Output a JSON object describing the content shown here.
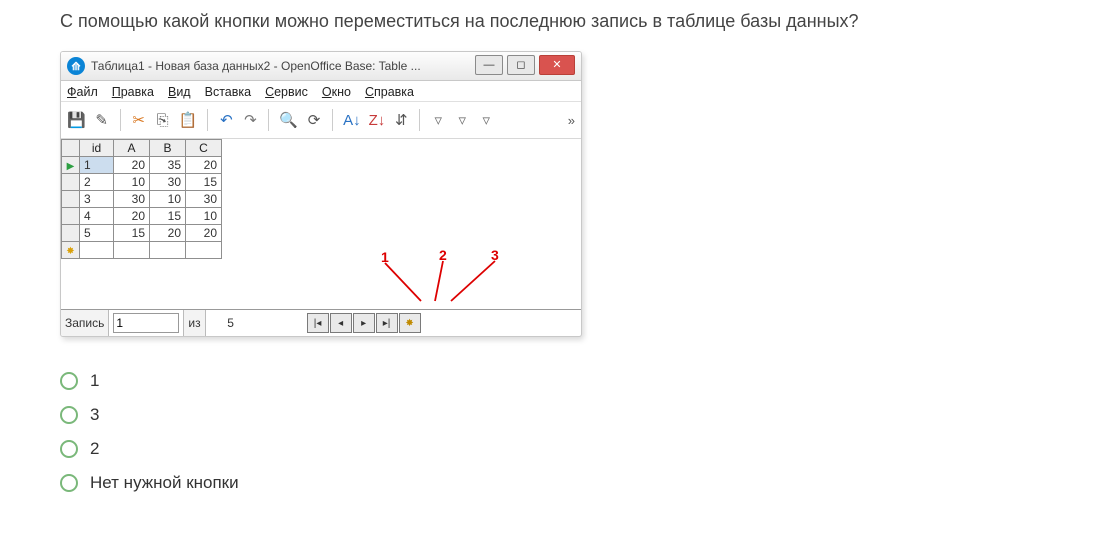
{
  "question": "С помощью какой кнопки можно переместиться на последнюю запись в таблице базы данных?",
  "window": {
    "title": "Таблица1 - Новая база данных2 - OpenOffice Base: Table ...",
    "menu": [
      {
        "u": "Ф",
        "r": "айл"
      },
      {
        "u": "П",
        "r": "равка"
      },
      {
        "u": "В",
        "r": "ид"
      },
      {
        "u": "",
        "r": "Вставка"
      },
      {
        "u": "С",
        "r": "ервис"
      },
      {
        "u": "О",
        "r": "кно"
      },
      {
        "u": "С",
        "r": "правка"
      }
    ]
  },
  "grid": {
    "cols": [
      "id",
      "A",
      "B",
      "C"
    ],
    "rows": [
      [
        "1",
        "20",
        "35",
        "20"
      ],
      [
        "2",
        "10",
        "30",
        "15"
      ],
      [
        "3",
        "30",
        "10",
        "30"
      ],
      [
        "4",
        "20",
        "15",
        "10"
      ],
      [
        "5",
        "15",
        "20",
        "20"
      ]
    ]
  },
  "annotations": [
    "1",
    "2",
    "3"
  ],
  "nav": {
    "label": "Запись",
    "current": "1",
    "of_label": "из",
    "total": "5"
  },
  "options": [
    "1",
    "3",
    "2",
    "Нет нужной кнопки"
  ]
}
